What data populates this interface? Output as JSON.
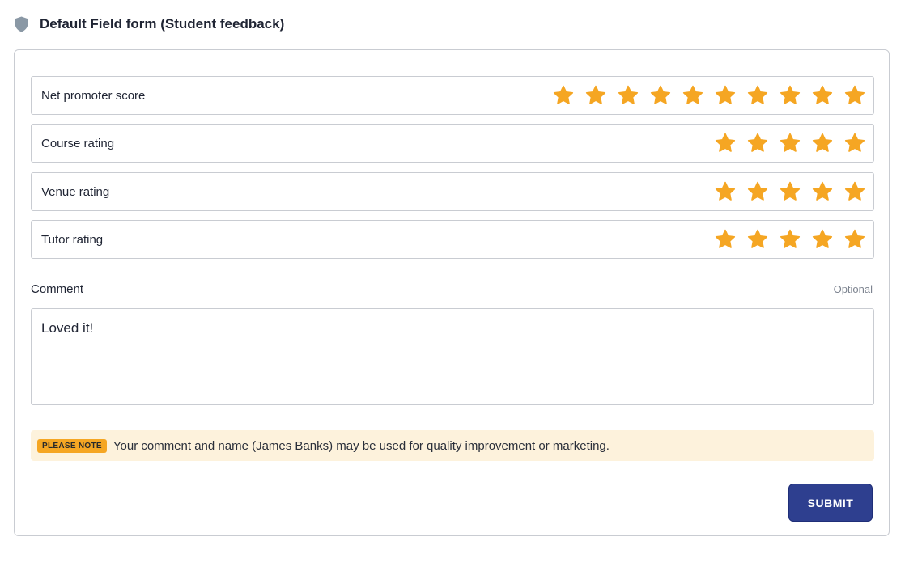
{
  "form": {
    "title": "Default Field form (Student feedback)",
    "title_icon": "shield-icon"
  },
  "ratings": [
    {
      "label": "Net promoter score",
      "max": 10,
      "value": 10
    },
    {
      "label": "Course rating",
      "max": 5,
      "value": 5
    },
    {
      "label": "Venue rating",
      "max": 5,
      "value": 5
    },
    {
      "label": "Tutor rating",
      "max": 5,
      "value": 5
    }
  ],
  "comment": {
    "label": "Comment",
    "optional_label": "Optional",
    "value": "Loved it!"
  },
  "note": {
    "badge": "PLEASE NOTE",
    "text": "Your comment and name (James Banks) may be used for quality improvement or marketing."
  },
  "actions": {
    "submit_label": "SUBMIT"
  },
  "colors": {
    "star": "#f5a623",
    "submit_bg": "#2e3f8f",
    "note_bg": "#fdf2dc",
    "shield": "#8a98a5"
  }
}
